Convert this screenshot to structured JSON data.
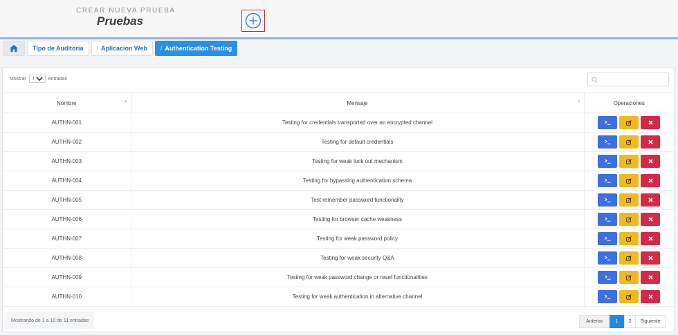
{
  "header": {
    "subtitle": "CREAR NUEVA PRUEBA",
    "title": "Pruebas"
  },
  "breadcrumb": {
    "items": [
      {
        "label": "Tipo de Auditoria",
        "sep": ""
      },
      {
        "label": "Aplicación Web",
        "sep": "/"
      },
      {
        "label": "Authentication Testing",
        "sep": "/"
      }
    ]
  },
  "table_controls": {
    "show_label": "Mostrar",
    "show_value": "10",
    "entries_label": "entradas"
  },
  "columns": {
    "name": "Nombre",
    "message": "Mensaje",
    "operations": "Operaciones"
  },
  "rows": [
    {
      "name": "AUTHN-001",
      "message": "Testing for credentials transported over an encrypted channel"
    },
    {
      "name": "AUTHN-002",
      "message": "Testing for default credentials"
    },
    {
      "name": "AUTHN-003",
      "message": "Testing for weak lock out mechanism"
    },
    {
      "name": "AUTHN-004",
      "message": "Testing for bypassing authentication schema"
    },
    {
      "name": "AUTHN-005",
      "message": "Test remember password functionality"
    },
    {
      "name": "AUTHN-006",
      "message": "Testing for browser cache weakness"
    },
    {
      "name": "AUTHN-007",
      "message": "Testing for weak password policy"
    },
    {
      "name": "AUTHN-008",
      "message": "Testing for weak security Q&A"
    },
    {
      "name": "AUTHN-009",
      "message": "Testing for weak password change or reset functionalities"
    },
    {
      "name": "AUTHN-010",
      "message": "Testing for weak authentication in alternative channel"
    }
  ],
  "operation_icons": {
    "run": "terminal-icon",
    "edit": "edit-icon",
    "delete": "close-icon"
  },
  "footer": {
    "info": "Mostrando de 1 a 10 de 11 entradas",
    "prev": "Anterior",
    "pages": [
      "1",
      "2"
    ],
    "next": "Siguiente"
  },
  "colors": {
    "run": "#3c6fe0",
    "edit": "#f1b91c",
    "delete": "#d42a4a",
    "active_crumb": "#2d8fe3"
  }
}
